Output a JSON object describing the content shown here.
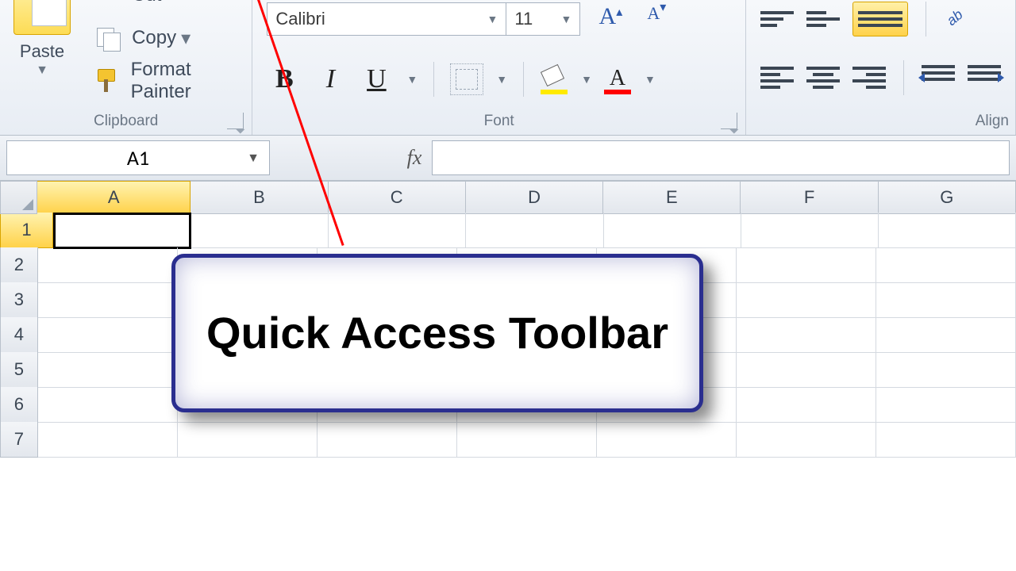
{
  "ribbon": {
    "clipboard": {
      "label": "Clipboard",
      "paste": "Paste",
      "cut": "Cut",
      "copy": "Copy",
      "format_painter": "Format Painter"
    },
    "font": {
      "label": "Font",
      "name": "Calibri",
      "size": "11",
      "bold": "B",
      "italic": "I",
      "underline": "U",
      "color_letter": "A"
    },
    "alignment": {
      "label": "Align"
    }
  },
  "formula_bar": {
    "name_box": "A1",
    "fx": "fx"
  },
  "grid": {
    "columns": [
      "A",
      "B",
      "C",
      "D",
      "E",
      "F",
      "G"
    ],
    "rows": [
      "1",
      "2",
      "3",
      "4",
      "5",
      "6",
      "7"
    ],
    "selected_col": "A",
    "selected_row": "1"
  },
  "callout": {
    "text": "Quick Access Toolbar"
  }
}
